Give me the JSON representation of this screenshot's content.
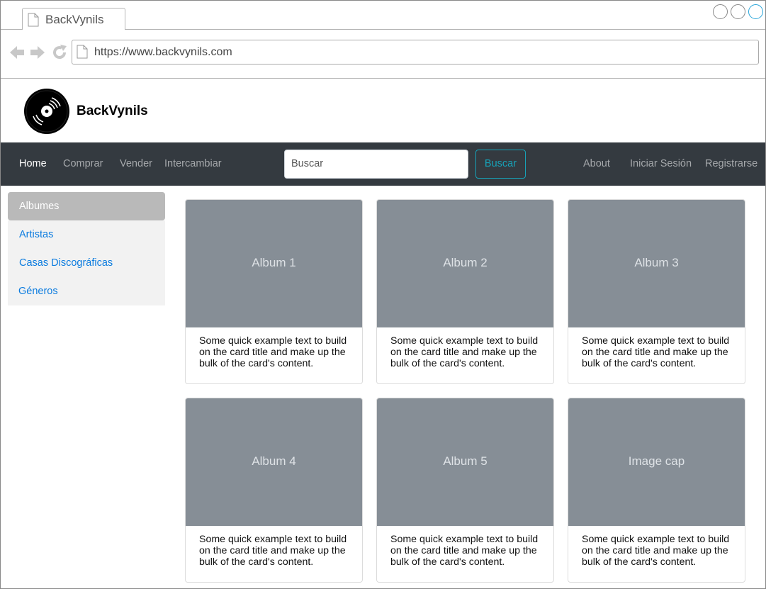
{
  "browser": {
    "tab_title": "BackVynils",
    "url": "https://www.backvynils.com"
  },
  "site": {
    "brand": "BackVynils",
    "logo_icon": "vinyl-record-icon"
  },
  "navbar": {
    "links_left": [
      {
        "label": "Home",
        "active": true
      },
      {
        "label": "Comprar",
        "active": false
      },
      {
        "label": "Vender",
        "active": false
      },
      {
        "label": "Intercambiar",
        "active": false
      }
    ],
    "search_placeholder": "Buscar",
    "search_button": "Buscar",
    "links_right": [
      {
        "label": "About"
      },
      {
        "label": "Iniciar Sesión"
      },
      {
        "label": "Registrarse"
      }
    ]
  },
  "sidebar": {
    "items": [
      {
        "label": "Albumes",
        "active": true
      },
      {
        "label": "Artistas",
        "active": false
      },
      {
        "label": "Casas Discográficas",
        "active": false
      },
      {
        "label": "Géneros",
        "active": false
      }
    ]
  },
  "cards": [
    {
      "caption": "Album 1",
      "text": "Some quick example text to build on the card title and make up the bulk of the card's content."
    },
    {
      "caption": "Album 2",
      "text": "Some quick example text to build on the card title and make up the bulk of the card's content."
    },
    {
      "caption": "Album 3",
      "text": "Some quick example text to build on the card title and make up the bulk of the card's content."
    },
    {
      "caption": "Album 4",
      "text": "Some quick example text to build on the card title and make up the bulk of the card's content."
    },
    {
      "caption": "Album 5",
      "text": "Some quick example text to build on the card title and make up the bulk of the card's content."
    },
    {
      "caption": "Image cap",
      "text": "Some quick example text to build on the card title and make up the bulk of the card's content."
    }
  ],
  "colors": {
    "navbar_bg": "#343a40",
    "search_button_accent": "#17a2b8",
    "sidebar_link": "#0a7bdf",
    "card_image_bg": "#868e96"
  }
}
